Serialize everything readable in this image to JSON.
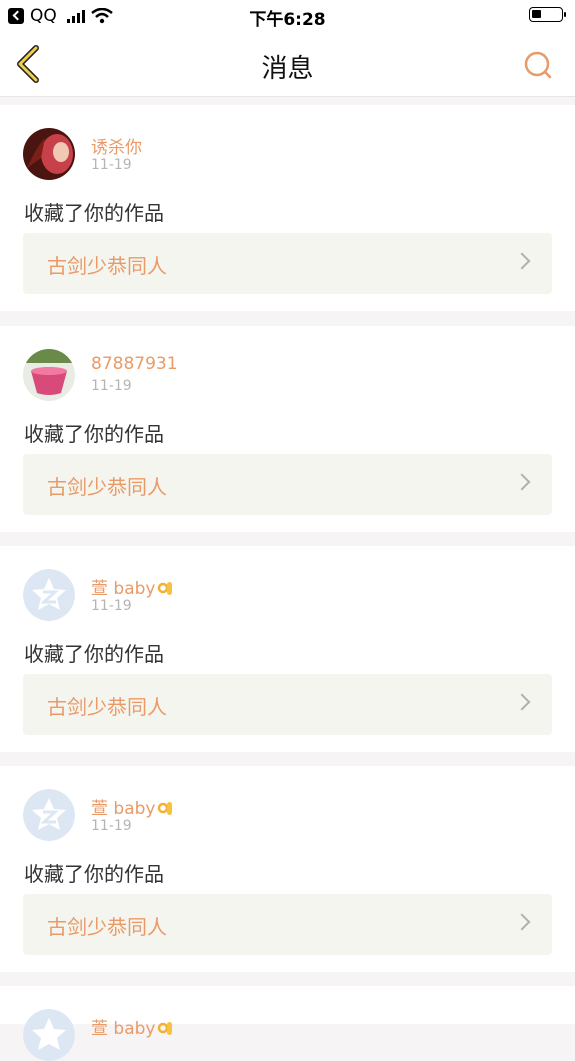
{
  "status_bar": {
    "carrier": "QQ",
    "time": "下午6:28"
  },
  "nav": {
    "title": "消息"
  },
  "colors": {
    "accent": "#e99a67",
    "work_bg": "#f5f5ef"
  },
  "messages": [
    {
      "user": "诱杀你",
      "date": "11-19",
      "action": "收藏了你的作品",
      "work": "古剑少恭同人",
      "avatar": "photo-red"
    },
    {
      "user": "87887931",
      "date": "11-19",
      "action": "收藏了你的作品",
      "work": "古剑少恭同人",
      "avatar": "photo-cake"
    },
    {
      "user": "萱 baby",
      "date": "11-19",
      "action": "收藏了你的作品",
      "work": "古剑少恭同人",
      "avatar": "qzone-default",
      "emoji": "ok-hand-icon"
    },
    {
      "user": "萱 baby",
      "date": "11-19",
      "action": "收藏了你的作品",
      "work": "古剑少恭同人",
      "avatar": "qzone-default",
      "emoji": "ok-hand-icon"
    },
    {
      "user": "萱 baby",
      "avatar": "qzone-default",
      "emoji": "ok-hand-icon"
    }
  ]
}
